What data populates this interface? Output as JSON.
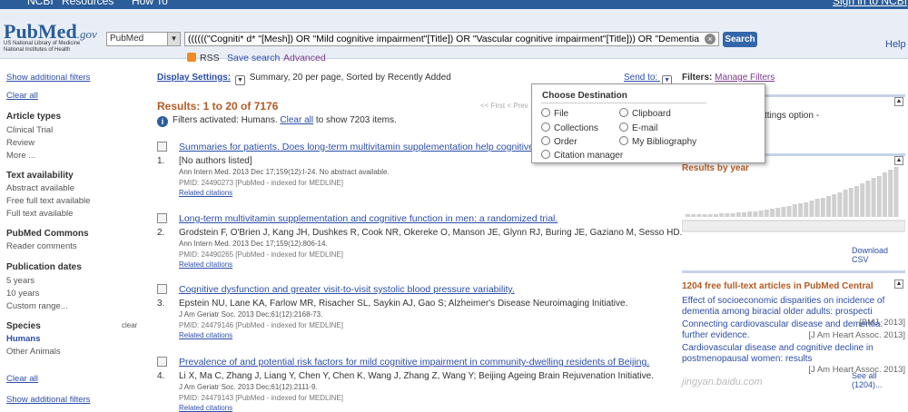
{
  "topbar": {
    "ncbi": "NCBI",
    "resources": "Resources",
    "howto": "How To",
    "signin": "Sign in to NCBI"
  },
  "header": {
    "logo": "PubMed",
    "logo_gov": ".gov",
    "logo_sub1": "US National Library of Medicine",
    "logo_sub2": "National Institutes of Health",
    "db_value": "PubMed",
    "query": "((((((\"Cogniti* d* \"[Mesh]) OR \"Mild cognitive impairment\"[Title]) OR \"Vascular cognitive impairment\"[Title])) OR \"Dementia",
    "search_label": "Search",
    "rss": "RSS",
    "save_search": "Save search",
    "advanced": "Advanced",
    "help": "Help"
  },
  "sidebar": {
    "show_filters_top": "Show additional filters",
    "clear_all_top": "Clear all",
    "article_types": "Article types",
    "article_items": [
      "Clinical Trial",
      "Review",
      "More ..."
    ],
    "text_availability": "Text availability",
    "text_items": [
      "Abstract available",
      "Free full text available",
      "Full text available"
    ],
    "pubmed_commons": "PubMed Commons",
    "commons_items": [
      "Reader comments"
    ],
    "pub_dates": "Publication dates",
    "date_items": [
      "5 years",
      "10 years",
      "Custom range..."
    ],
    "species": "Species",
    "species_clear": "clear",
    "species_items": [
      "Humans",
      "Other Animals"
    ],
    "clear_all_bottom": "Clear all",
    "show_filters_bottom": "Show additional filters"
  },
  "main": {
    "display_settings": "Display Settings:",
    "display_value": "Summary, 20 per page, Sorted by Recently Added",
    "results": "Results: 1 to 20 of 7176",
    "pager": "<< First   < Prev",
    "filter_msg_pre": "Filters activated: Humans.",
    "filter_clear": "Clear all",
    "filter_msg_post": "to show 7203 items.",
    "records": [
      {
        "num": "1.",
        "title": "Summaries for patients. Does long-term multivitamin supplementation help cognitive f",
        "authors": "[No authors listed]",
        "journal": "Ann Intern Med. 2013 Dec 17;159(12):I-24. No abstract available.",
        "pmid": "PMID: 24490273 [PubMed - indexed for MEDLINE]",
        "related": "Related citations"
      },
      {
        "num": "2.",
        "title": "Long-term multivitamin supplementation and cognitive function in men: a randomized trial.",
        "authors": "Grodstein F, O'Brien J, Kang JH, Dushkes R, Cook NR, Okereke O, Manson JE, Glynn RJ, Buring JE, Gaziano M, Sesso HD.",
        "journal": "Ann Intern Med. 2013 Dec 17;159(12):806-14.",
        "pmid": "PMID: 24490265 [PubMed - indexed for MEDLINE]",
        "related": "Related citations"
      },
      {
        "num": "3.",
        "title": "Cognitive dysfunction and greater visit-to-visit systolic blood pressure variability.",
        "authors": "Epstein NU, Lane KA, Farlow MR, Risacher SL, Saykin AJ, Gao S; Alzheimer's Disease Neuroimaging Initiative.",
        "journal": "J Am Geriatr Soc. 2013 Dec;61(12):2168-73.",
        "pmid": "PMID: 24479146 [PubMed - indexed for MEDLINE]",
        "related": "Related citations"
      },
      {
        "num": "4.",
        "title": "Prevalence of and potential risk factors for mild cognitive impairment in community-dwelling residents of Beijing.",
        "authors": "Li X, Ma C, Zhang J, Liang Y, Chen Y, Chen K, Wang J, Zhang Z, Wang Y; Beijing Ageing Brain Rejuvenation Initiative.",
        "journal": "J Am Geriatr Soc. 2013 Dec;61(12):2111-9.",
        "pmid": "PMID: 24479143 [PubMed - indexed for MEDLINE]",
        "related": "Related citations"
      }
    ]
  },
  "sendto": {
    "label": "Send to:",
    "popup_title": "Choose Destination",
    "options": [
      "File",
      "Clipboard",
      "Collections",
      "E-mail",
      "Order",
      "My Bibliography",
      "Citation manager"
    ]
  },
  "right": {
    "filters_label": "Filters:",
    "manage_filters": "Manage Filters",
    "settings_text": "ttings option -",
    "results_by_year": "Results by year",
    "download_csv": "Download CSV",
    "fulltext_head": "1204 free full-text articles in PubMed Central",
    "articles": [
      {
        "title": "Effect of socioeconomic disparities on incidence of dementia among biracial older adults: prospecti",
        "src": "[BMJ. 2013]"
      },
      {
        "title": "Connecting cardiovascular disease and dementia: further evidence.",
        "src": "[J Am Heart Assoc. 2013]"
      },
      {
        "title": "Cardiovascular disease and cognitive decline in postmenopausal women: results",
        "src": "[J Am Heart Assoc. 2013]"
      }
    ],
    "see_all": "See all (1204)...",
    "watermark": "jingyan.baidu.com"
  },
  "colors": {
    "link": "#2b4ea8",
    "results": "#b35a24",
    "header_bg": "#e9eef6",
    "topbar": "#2b5d9a"
  }
}
